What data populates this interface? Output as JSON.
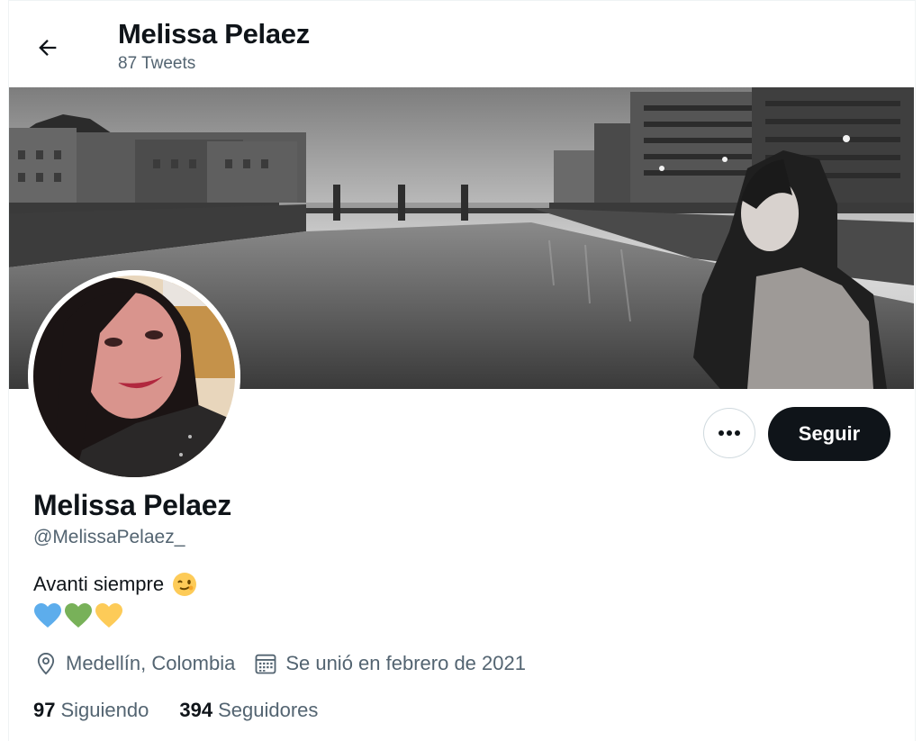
{
  "header": {
    "name": "Melissa Pelaez",
    "tweet_count": "87 Tweets"
  },
  "banner": {
    "icon": "banner-photo-river-bridge-grayscale"
  },
  "avatar": {
    "icon": "profile-avatar-photo"
  },
  "actions": {
    "more_icon": "more-horizontal-icon",
    "follow_label": "Seguir"
  },
  "profile": {
    "display_name": "Melissa Pelaez",
    "handle": "@MelissaPelaez_",
    "bio_text": "Avanti siempre",
    "bio_emojis": [
      "winking-face",
      "blue-heart",
      "green-heart",
      "yellow-heart"
    ],
    "location": "Medellín, Colombia",
    "joined": "Se unió en febrero de 2021"
  },
  "stats": {
    "following_count": "97",
    "following_label": "Siguiendo",
    "followers_count": "394",
    "followers_label": "Seguidores"
  },
  "colors": {
    "text_primary": "#0f1419",
    "text_secondary": "#536471",
    "follow_button_bg": "#0f1419",
    "border": "#cfd9de",
    "heart_blue": "#5dadec",
    "heart_green": "#78b159",
    "heart_yellow": "#fdcb58"
  }
}
